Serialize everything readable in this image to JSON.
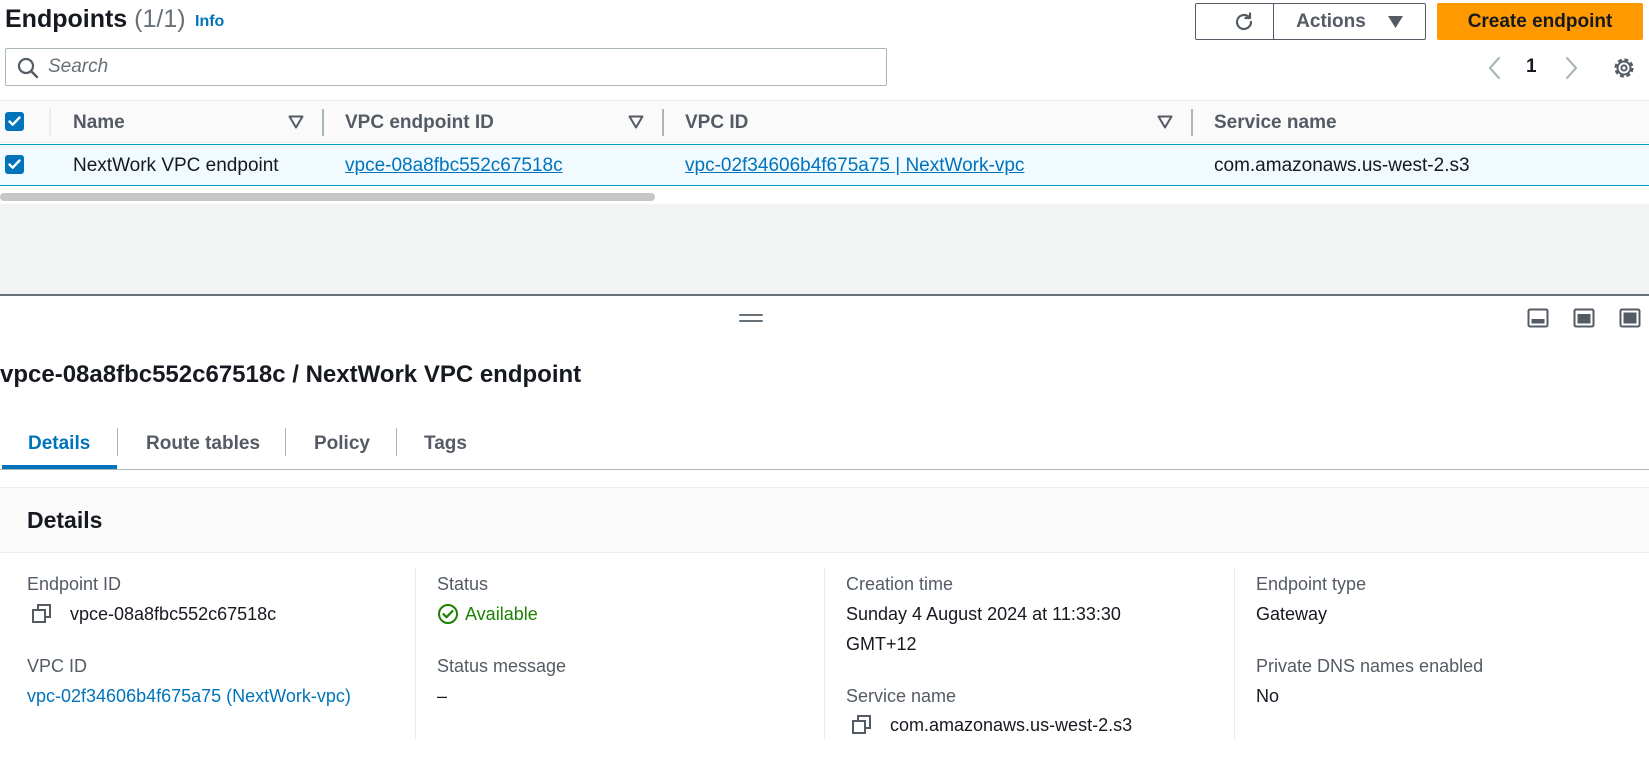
{
  "header": {
    "title": "Endpoints",
    "count": "(1/1)",
    "info_label": "Info",
    "actions_label": "Actions",
    "create_label": "Create endpoint"
  },
  "search": {
    "placeholder": "Search",
    "value": ""
  },
  "pagination": {
    "current_page": "1"
  },
  "table": {
    "columns": [
      "Name",
      "VPC endpoint ID",
      "VPC ID",
      "Service name"
    ],
    "rows": [
      {
        "selected": true,
        "name": "NextWork VPC endpoint",
        "vpc_endpoint_id": "vpce-08a8fbc552c67518c",
        "vpc_id": "vpc-02f34606b4f675a75 | NextWork-vpc",
        "service_name": "com.amazonaws.us-west-2.s3"
      }
    ]
  },
  "detail": {
    "title": "vpce-08a8fbc552c67518c / NextWork VPC endpoint",
    "tabs": [
      {
        "label": "Details",
        "active": true
      },
      {
        "label": "Route tables",
        "active": false
      },
      {
        "label": "Policy",
        "active": false
      },
      {
        "label": "Tags",
        "active": false
      }
    ],
    "section_title": "Details",
    "fields": {
      "endpoint_id": {
        "label": "Endpoint ID",
        "value": "vpce-08a8fbc552c67518c"
      },
      "vpc_id": {
        "label": "VPC ID",
        "value": "vpc-02f34606b4f675a75 (NextWork-vpc)"
      },
      "status": {
        "label": "Status",
        "value": "Available"
      },
      "status_message": {
        "label": "Status message",
        "value": "–"
      },
      "creation_time": {
        "label": "Creation time",
        "value_line1": "Sunday 4 August 2024 at 11:33:30",
        "value_line2": "GMT+12"
      },
      "service_name": {
        "label": "Service name",
        "value": "com.amazonaws.us-west-2.s3"
      },
      "endpoint_type": {
        "label": "Endpoint type",
        "value": "Gateway"
      },
      "private_dns": {
        "label": "Private DNS names enabled",
        "value": "No"
      }
    }
  },
  "colors": {
    "accent": "#0073bb",
    "primary_button": "#ff9900",
    "status_ok": "#1d8102",
    "selected_row_bg": "#f1faff"
  },
  "icons": [
    "refresh-icon",
    "caret-down-icon",
    "search-icon",
    "chevron-left-icon",
    "chevron-right-icon",
    "gear-icon",
    "sort-icon",
    "checkbox-icon",
    "drag-handle-icon",
    "copy-icon",
    "status-ok-icon",
    "panel-bottom-icon",
    "panel-side-icon",
    "panel-full-icon"
  ]
}
